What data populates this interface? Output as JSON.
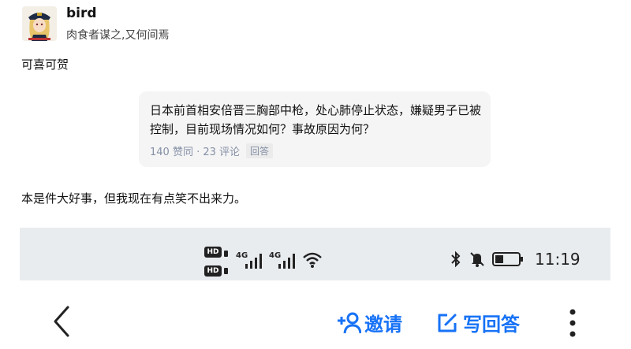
{
  "user": {
    "name": "bird",
    "bio": "肉食者谋之,又何间焉"
  },
  "comments": [
    "可喜可贺",
    "本是件大好事，但我现在有点笑不出来力。"
  ],
  "quote": {
    "title": "日本前首相安倍晋三胸部中枪，处心肺停止状态，嫌疑男子已被控制，目前现场情况如何？事故原因为何？",
    "meta": "140 赞同 · 23 评论",
    "tag": "回答"
  },
  "status": {
    "hd1": "HD",
    "hd2": "HD",
    "net1": "4G",
    "net2": "4G",
    "time": "11:19"
  },
  "toolbar": {
    "invite_label": "邀请",
    "write_label": "写回答"
  },
  "colors": {
    "accent": "#1772f6",
    "quote_bg": "#f5f5f5",
    "status_bg": "#e9ecef"
  },
  "icons": [
    "avatar",
    "hd-icon",
    "signal-icon",
    "wifi-icon",
    "bluetooth-icon",
    "mute-icon",
    "battery-icon",
    "back-icon",
    "invite-icon",
    "edit-icon",
    "more-icon"
  ]
}
